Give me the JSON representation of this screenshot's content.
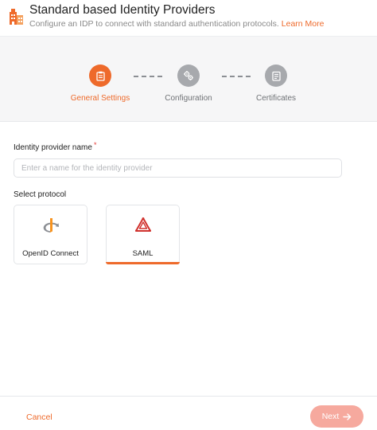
{
  "header": {
    "title": "Standard based Identity Providers",
    "subtitle": "Configure an IDP to connect with standard authentication protocols.",
    "learn_more": "Learn More",
    "icon": "building-icon"
  },
  "stepper": {
    "steps": [
      {
        "label": "General Settings",
        "icon": "clipboard-icon",
        "state": "active"
      },
      {
        "label": "Configuration",
        "icon": "gears-icon",
        "state": "inactive"
      },
      {
        "label": "Certificates",
        "icon": "certificate-icon",
        "state": "inactive"
      }
    ]
  },
  "form": {
    "name_label": "Identity provider name",
    "required_mark": "*",
    "name_value": "",
    "name_placeholder": "Enter a name for the identity provider",
    "protocol_label": "Select protocol",
    "protocols": [
      {
        "label": "OpenID Connect",
        "icon": "openid-icon",
        "selected": false
      },
      {
        "label": "SAML",
        "icon": "saml-icon",
        "selected": true
      }
    ]
  },
  "footer": {
    "cancel_label": "Cancel",
    "next_label": "Next",
    "next_enabled": false
  },
  "colors": {
    "accent": "#ee6a2b",
    "inactive_step": "#a7a9ad",
    "next_disabled": "#f6a99e"
  }
}
